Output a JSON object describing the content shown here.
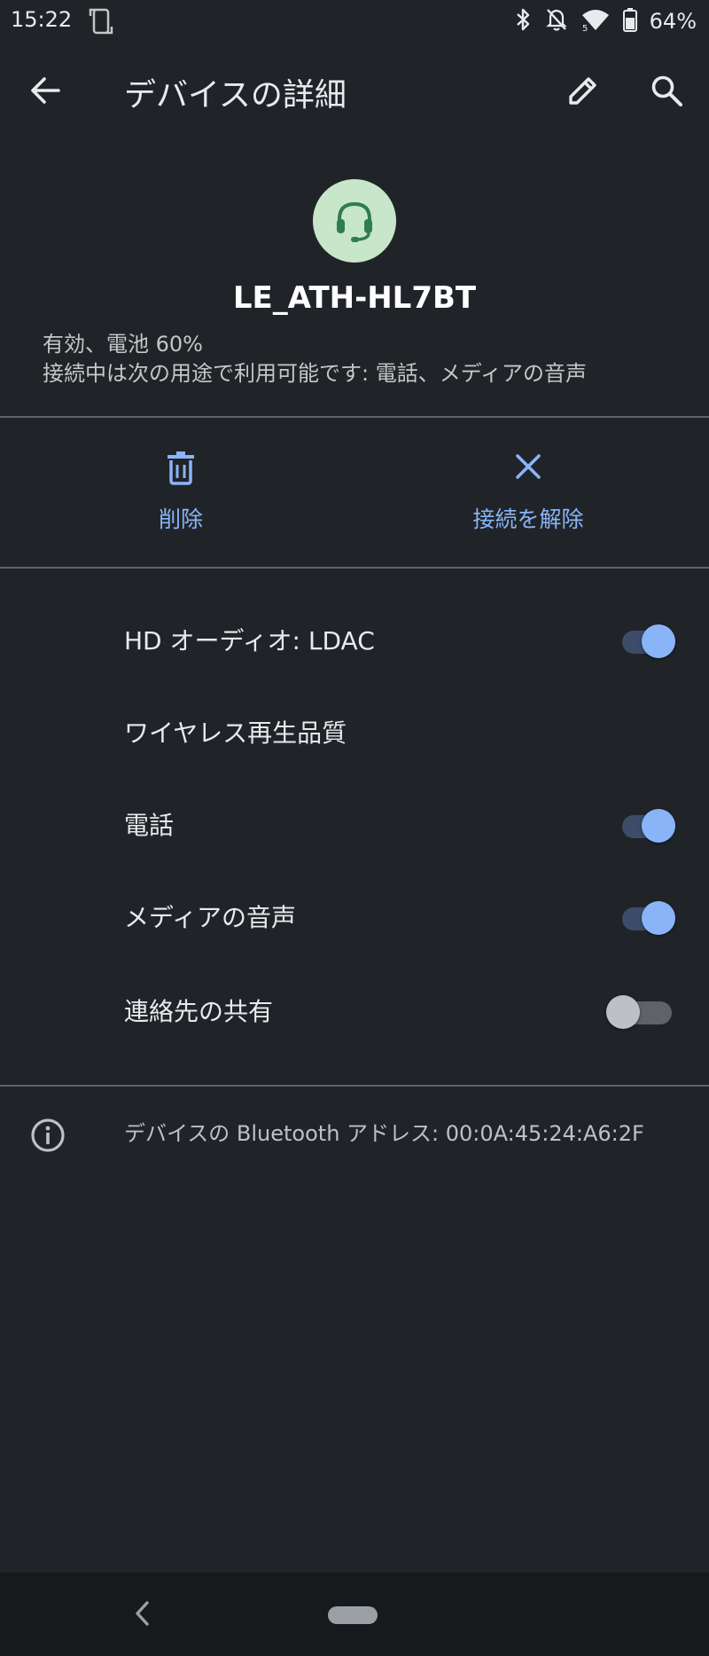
{
  "status_bar": {
    "time": "15:22",
    "battery": "64%",
    "icons": [
      "screenshot-icon",
      "bluetooth-icon",
      "notifications-off-icon",
      "wifi-icon",
      "battery-icon"
    ]
  },
  "app_bar": {
    "title": "デバイスの詳細",
    "icons": [
      "back-arrow-icon",
      "edit-pencil-icon",
      "search-icon"
    ]
  },
  "device": {
    "name": "LE_ATH-HL7BT",
    "icon": "headset-icon",
    "status_line1": "有効、電池 60%",
    "status_line2": "接続中は次の用途で利用可能です: 電話、メディアの音声"
  },
  "actions": {
    "delete_label": "削除",
    "disconnect_label": "接続を解除",
    "icons": [
      "trash-icon",
      "close-icon"
    ]
  },
  "settings": [
    {
      "label": "HD オーディオ: LDAC",
      "toggle": true
    },
    {
      "label": "ワイヤレス再生品質"
    },
    {
      "label": "電話",
      "toggle": true
    },
    {
      "label": "メディアの音声",
      "toggle": true
    },
    {
      "label": "連絡先の共有",
      "toggle": false
    }
  ],
  "info": {
    "bt_address": "デバイスの Bluetooth アドレス: 00:0A:45:24:A6:2F",
    "icon": "info-icon"
  },
  "colors": {
    "background": "#202428",
    "accent": "#8ab4f8",
    "avatar_bg": "#c8e6c9",
    "avatar_fg": "#2e7d4f"
  }
}
